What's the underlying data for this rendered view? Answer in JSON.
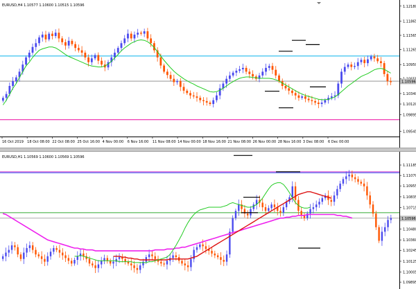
{
  "chart_data": [
    {
      "type": "candlestick",
      "title": "EURUSD,H4  1.10577 1.10600 1.10515 1.10596",
      "ylim": [
        1.0945,
        1.1225
      ],
      "yticks": [
        "1.12180",
        "1.11865",
        "1.11565",
        "1.11265",
        "1.10950",
        "1.10655",
        "1.10340",
        "1.10120",
        "1.09895",
        "1.09545"
      ],
      "ytick_values": [
        1.1218,
        1.11865,
        1.11565,
        1.11265,
        1.1095,
        1.10655,
        1.1034,
        1.1012,
        1.09895,
        1.09545
      ],
      "xticks": [
        "16 Oct 2019",
        "18 Oct 08:00",
        "22 Oct 08:00",
        "25 Oct 16:00",
        "4 Nov 00:00",
        "6 Nov 16:00",
        "11 Nov 08:00",
        "14 Nov 00:00",
        "18 Nov 16:00",
        "21 Nov 08:00",
        "26 Nov 00:00",
        "28 Nov 16:00",
        "3 Dec 08:00",
        "6 Dec 00:00"
      ],
      "price_label": "1.10596",
      "price_label_value": 1.10596,
      "colors": {
        "bull": "#4a4aee",
        "bear": "#ff5500",
        "ma": "#22cc22",
        "hline_cyan": "#22bbee",
        "hline_magenta": "#ee22aa",
        "hline_grey": "#aaaaaa",
        "marker": "#000000"
      },
      "hlines": [
        {
          "value": 1.1113,
          "color": "cyan"
        },
        {
          "value": 1.106,
          "color": "grey"
        },
        {
          "value": 1.0979,
          "color": "magenta"
        }
      ],
      "closes": [
        1.1025,
        1.1033,
        1.105,
        1.106,
        1.1068,
        1.108,
        1.1095,
        1.111,
        1.112,
        1.1132,
        1.114,
        1.1152,
        1.1158,
        1.1148,
        1.116,
        1.1155,
        1.1162,
        1.115,
        1.1142,
        1.1135,
        1.1145,
        1.1138,
        1.113,
        1.1125,
        1.112,
        1.111,
        1.11,
        1.1108,
        1.1115,
        1.1103,
        1.1095,
        1.1089,
        1.11,
        1.111,
        1.112,
        1.113,
        1.114,
        1.115,
        1.116,
        1.115,
        1.1158,
        1.1162,
        1.116,
        1.1165,
        1.115,
        1.114,
        1.1125,
        1.111,
        1.1093,
        1.108,
        1.1073,
        1.1065,
        1.1058,
        1.106,
        1.1048,
        1.104,
        1.1035,
        1.103,
        1.1028,
        1.1025,
        1.102,
        1.1018,
        1.1015,
        1.1012,
        1.102,
        1.103,
        1.1045,
        1.1055,
        1.1065,
        1.1072,
        1.1078,
        1.1082,
        1.1085,
        1.1088,
        1.108,
        1.1075,
        1.107,
        1.1065,
        1.1072,
        1.108,
        1.1088,
        1.1092,
        1.1084,
        1.1072,
        1.106,
        1.105,
        1.1045,
        1.104,
        1.1035,
        1.103,
        1.1025,
        1.1028,
        1.1023,
        1.102,
        1.1018,
        1.1015,
        1.1012,
        1.1015,
        1.102,
        1.1025,
        1.1028,
        1.103,
        1.1055,
        1.108,
        1.109,
        1.1095,
        1.109,
        1.1092,
        1.11,
        1.1105,
        1.1098,
        1.1106,
        1.1112,
        1.1108,
        1.1102,
        1.1098,
        1.1075,
        1.106,
        1.1058
      ],
      "ma_values": [
        1.101,
        1.102,
        1.1032,
        1.1045,
        1.1055,
        1.1068,
        1.108,
        1.1092,
        1.11,
        1.111,
        1.1118,
        1.1125,
        1.1128,
        1.113,
        1.1132,
        1.1132,
        1.113,
        1.1126,
        1.1121,
        1.1116,
        1.1112,
        1.1109,
        1.1106,
        1.1103,
        1.11,
        1.1097,
        1.1094,
        1.1092,
        1.1091,
        1.109,
        1.109,
        1.1092,
        1.1096,
        1.1102,
        1.1109,
        1.1116,
        1.1124,
        1.113,
        1.1135,
        1.114,
        1.1143,
        1.1146,
        1.1147,
        1.1146,
        1.1143,
        1.1138,
        1.1131,
        1.1122,
        1.1113,
        1.1104,
        1.1096,
        1.1088,
        1.1081,
        1.1075,
        1.107,
        1.1065,
        1.1061,
        1.1057,
        1.1054,
        1.105,
        1.1047,
        1.1044,
        1.1041,
        1.1038,
        1.1037,
        1.1038,
        1.1041,
        1.1045,
        1.105,
        1.1055,
        1.1059,
        1.1063,
        1.1066,
        1.1068,
        1.1069,
        1.1069,
        1.1068,
        1.1067,
        1.1066,
        1.1066,
        1.1066,
        1.1066,
        1.1065,
        1.1063,
        1.106,
        1.1056,
        1.1052,
        1.1048,
        1.1044,
        1.104,
        1.1036,
        1.1033,
        1.103,
        1.1028,
        1.1026,
        1.1024,
        1.1022,
        1.1021,
        1.1021,
        1.1022,
        1.1024,
        1.1027,
        1.1032,
        1.1038,
        1.1044,
        1.105,
        1.1055,
        1.106,
        1.1065,
        1.107,
        1.1073,
        1.1076,
        1.108,
        1.1084,
        1.1086,
        1.1087,
        1.1085,
        1.1081,
        1.1077
      ]
    },
    {
      "type": "candlestick",
      "title": "EURUSD,H1  1.10569 1.10600 1.10569 1.10596",
      "ylim": [
        1.0985,
        1.113
      ],
      "yticks": [
        "1.11185",
        "1.11070",
        "1.10955",
        "1.10835",
        "1.10715",
        "1.10596",
        "1.10480",
        "1.10360",
        "1.10245",
        "1.10125",
        "1.10005",
        "1.09895"
      ],
      "ytick_values": [
        1.11185,
        1.1107,
        1.10955,
        1.10835,
        1.10715,
        1.10596,
        1.1048,
        1.1036,
        1.10245,
        1.10125,
        1.10005,
        1.09895
      ],
      "price_label": "1.10596",
      "price_label_value": 1.10596,
      "hlines": [
        {
          "value": 1.1111,
          "color": "magenta"
        },
        {
          "value": 1.111,
          "color": "blue"
        },
        {
          "value": 1.1066,
          "color": "green"
        },
        {
          "value": 1.106,
          "color": "grey"
        }
      ],
      "closes": [
        1.1018,
        1.1022,
        1.1025,
        1.103,
        1.1028,
        1.102,
        1.1015,
        1.1022,
        1.1027,
        1.103,
        1.1025,
        1.102,
        1.1018,
        1.1015,
        1.1012,
        1.1018,
        1.1023,
        1.1027,
        1.1025,
        1.1022,
        1.1019,
        1.1016,
        1.1013,
        1.101,
        1.1014,
        1.1018,
        1.1021,
        1.1018,
        1.1015,
        1.101,
        1.1008,
        1.1005,
        1.1009,
        1.1013,
        1.1016,
        1.1013,
        1.101,
        1.1012,
        1.1015,
        1.1017,
        1.1015,
        1.1012,
        1.101,
        1.1008,
        1.1005,
        1.1003,
        1.1008,
        1.1012,
        1.1017,
        1.102,
        1.1018,
        1.1015,
        1.1012,
        1.101,
        1.1009,
        1.1013,
        1.1016,
        1.1019,
        1.1017,
        1.1013,
        1.101,
        1.1008,
        1.1006,
        1.1015,
        1.1025,
        1.1028,
        1.1031,
        1.1029,
        1.1026,
        1.1024,
        1.1021,
        1.1019,
        1.1017,
        1.1014,
        1.1012,
        1.102,
        1.1045,
        1.106,
        1.1068,
        1.1075,
        1.107,
        1.1065,
        1.1063,
        1.107,
        1.1075,
        1.108,
        1.1077,
        1.1072,
        1.1068,
        1.1071,
        1.1075,
        1.1072,
        1.1068,
        1.1066,
        1.1072,
        1.1078,
        1.1083,
        1.1095,
        1.108,
        1.1068,
        1.1063,
        1.106,
        1.1065,
        1.107,
        1.1072,
        1.1075,
        1.1078,
        1.1082,
        1.1085,
        1.108,
        1.1078,
        1.1085,
        1.1092,
        1.1098,
        1.1103,
        1.1106,
        1.1108,
        1.1105,
        1.1103,
        1.11,
        1.1098,
        1.1095,
        1.1085,
        1.1075,
        1.1065,
        1.105,
        1.1035,
        1.1045,
        1.105,
        1.1058,
        1.106
      ],
      "ma_green": [
        null,
        null,
        null,
        null,
        null,
        null,
        null,
        null,
        null,
        null,
        null,
        null,
        null,
        null,
        null,
        null,
        null,
        null,
        null,
        null,
        null,
        null,
        null,
        null,
        1.1018,
        1.1018,
        1.1019,
        1.1018,
        1.1017,
        1.1016,
        1.1015,
        1.1014,
        1.1013,
        1.1013,
        1.1013,
        1.1013,
        1.1013,
        1.1013,
        1.1013,
        1.1012,
        1.1012,
        1.1012,
        1.1012,
        1.1012,
        1.1011,
        1.1011,
        1.1011,
        1.1011,
        1.1011,
        1.1012,
        1.1012,
        1.1013,
        1.1014,
        1.1015,
        1.1016,
        1.1017,
        1.102,
        1.1025,
        1.103,
        1.1036,
        1.1042,
        1.1049,
        1.1055,
        1.106,
        1.1064,
        1.1067,
        1.1069,
        1.107,
        1.1071,
        1.1072,
        1.1072,
        1.1072,
        1.1072,
        1.1072,
        1.1073,
        1.1074,
        1.1076,
        1.1077,
        1.1076,
        1.1075,
        1.1074,
        1.1073,
        1.1072,
        1.1072,
        1.1073,
        1.1075,
        1.1078,
        1.1082,
        1.1087,
        1.1092,
        1.1096,
        1.1098,
        1.1099,
        1.1099,
        1.1097,
        1.1093,
        1.1088,
        1.1082,
        1.1077,
        1.1074,
        1.1072,
        1.1071,
        1.1071,
        1.1072
      ],
      "ma_red": [
        null,
        null,
        null,
        null,
        null,
        null,
        null,
        null,
        null,
        null,
        null,
        null,
        null,
        null,
        null,
        null,
        null,
        null,
        null,
        null,
        null,
        null,
        null,
        null,
        null,
        null,
        null,
        null,
        null,
        null,
        null,
        null,
        null,
        null,
        null,
        null,
        null,
        1.1018,
        1.1018,
        1.1018,
        1.1017,
        1.1017,
        1.1016,
        1.1016,
        1.1015,
        1.1015,
        1.1014,
        1.1014,
        1.1014,
        1.1014,
        1.1014,
        1.1014,
        1.1014,
        1.1014,
        1.1014,
        1.1014,
        1.1015,
        1.1015,
        1.1015,
        1.1015,
        1.1015,
        1.1015,
        1.1015,
        1.1016,
        1.1017,
        1.1018,
        1.102,
        1.1022,
        1.1024,
        1.1026,
        1.1028,
        1.103,
        1.1032,
        1.1034,
        1.1036,
        1.1038,
        1.104,
        1.1042,
        1.1044,
        1.1046,
        1.1048,
        1.105,
        1.1052,
        1.1054,
        1.1056,
        1.1058,
        1.106,
        1.1062,
        1.1064,
        1.1066,
        1.1068,
        1.107,
        1.1072,
        1.1074,
        1.1076,
        1.1078,
        1.108,
        1.1082,
        1.1084,
        1.1086,
        1.1087,
        1.1088,
        1.1089,
        1.1089,
        1.1088,
        1.1087,
        1.1086,
        1.1085,
        1.1084,
        1.1083,
        1.1082
      ],
      "ma_magenta": [
        1.1065,
        1.1064,
        1.1062,
        1.106,
        1.1058,
        1.1056,
        1.1054,
        1.1052,
        1.105,
        1.1048,
        1.1046,
        1.1044,
        1.1042,
        1.104,
        1.1038,
        1.1036,
        1.1035,
        1.1034,
        1.1033,
        1.1032,
        1.1031,
        1.103,
        1.1029,
        1.1028,
        1.1027,
        1.1027,
        1.1026,
        1.1026,
        1.1025,
        1.1025,
        1.1025,
        1.1024,
        1.1024,
        1.1024,
        1.1024,
        1.1024,
        1.1024,
        1.1024,
        1.1024,
        1.1024,
        1.1024,
        1.1024,
        1.1024,
        1.1024,
        1.1024,
        1.1024,
        1.1024,
        1.1024,
        1.1024,
        1.1024,
        1.1024,
        1.1025,
        1.1025,
        1.1025,
        1.1025,
        1.1026,
        1.1026,
        1.1026,
        1.1027,
        1.1027,
        1.1028,
        1.1028,
        1.1029,
        1.103,
        1.1031,
        1.1032,
        1.1033,
        1.1034,
        1.1035,
        1.1036,
        1.1037,
        1.1038,
        1.1039,
        1.104,
        1.1041,
        1.1042,
        1.1043,
        1.1044,
        1.1045,
        1.1046,
        1.1047,
        1.1048,
        1.1049,
        1.105,
        1.1051,
        1.1052,
        1.1053,
        1.1054,
        1.1055,
        1.1056,
        1.1057,
        1.1058,
        1.1059,
        1.106,
        1.106,
        1.1061,
        1.1061,
        1.1062,
        1.1062,
        1.1063,
        1.1063,
        1.1063,
        1.1064,
        1.1064,
        1.1064,
        1.1064,
        1.1064,
        1.1064,
        1.1064,
        1.1064,
        1.1064,
        1.1064,
        1.1063,
        1.1063,
        1.1062,
        1.1062,
        1.1061,
        1.106
      ]
    }
  ]
}
